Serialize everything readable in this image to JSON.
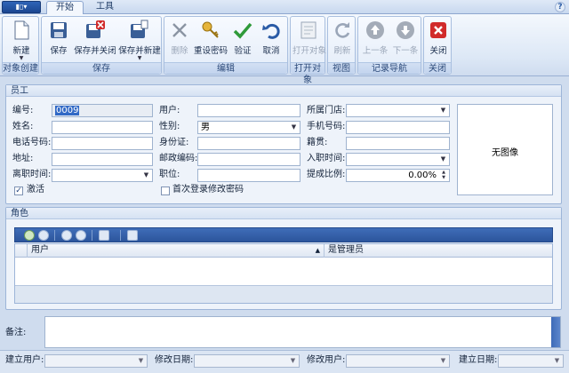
{
  "tabs": {
    "start": "开始",
    "tools": "工具"
  },
  "ribbon": {
    "groups": {
      "create": "对象创建",
      "save": "保存",
      "edit": "编辑",
      "open": "打开对象",
      "view": "视图",
      "nav": "记录导航",
      "close": "关闭"
    },
    "buttons": {
      "new": "新建",
      "save": "保存",
      "save_close": "保存并关闭",
      "save_new": "保存并新建",
      "delete": "删除",
      "reset_password": "重设密码",
      "verify": "验证",
      "cancel": "取消",
      "open_object": "打开对象",
      "refresh": "刷新",
      "prev": "上一条",
      "next": "下一条",
      "close": "关闭"
    }
  },
  "employee": {
    "title": "员工",
    "labels": {
      "id": "编号:",
      "user": "用户:",
      "store": "所属门店:",
      "name": "姓名:",
      "gender": "性别:",
      "mobile": "手机号码:",
      "phone": "电话号码:",
      "idcard": "身份证:",
      "hometown": "籍贯:",
      "address": "地址:",
      "postcode": "邮政编码:",
      "join_date": "入职时间:",
      "leave_date": "离职时间:",
      "position": "职位:",
      "commission": "提成比例:",
      "active": "激活",
      "change_pwd": "首次登录修改密码"
    },
    "values": {
      "id": "0009",
      "gender": "男",
      "commission": "0.00%"
    },
    "active_checked": true,
    "change_pwd_checked": false,
    "photo": "无图像"
  },
  "roles": {
    "title": "角色",
    "columns": [
      "用户",
      "是管理员"
    ]
  },
  "remark_label": "备注:",
  "footer": {
    "created_by": "建立用户:",
    "modified_date": "修改日期:",
    "modified_by": "修改用户:",
    "created_date": "建立日期:"
  }
}
